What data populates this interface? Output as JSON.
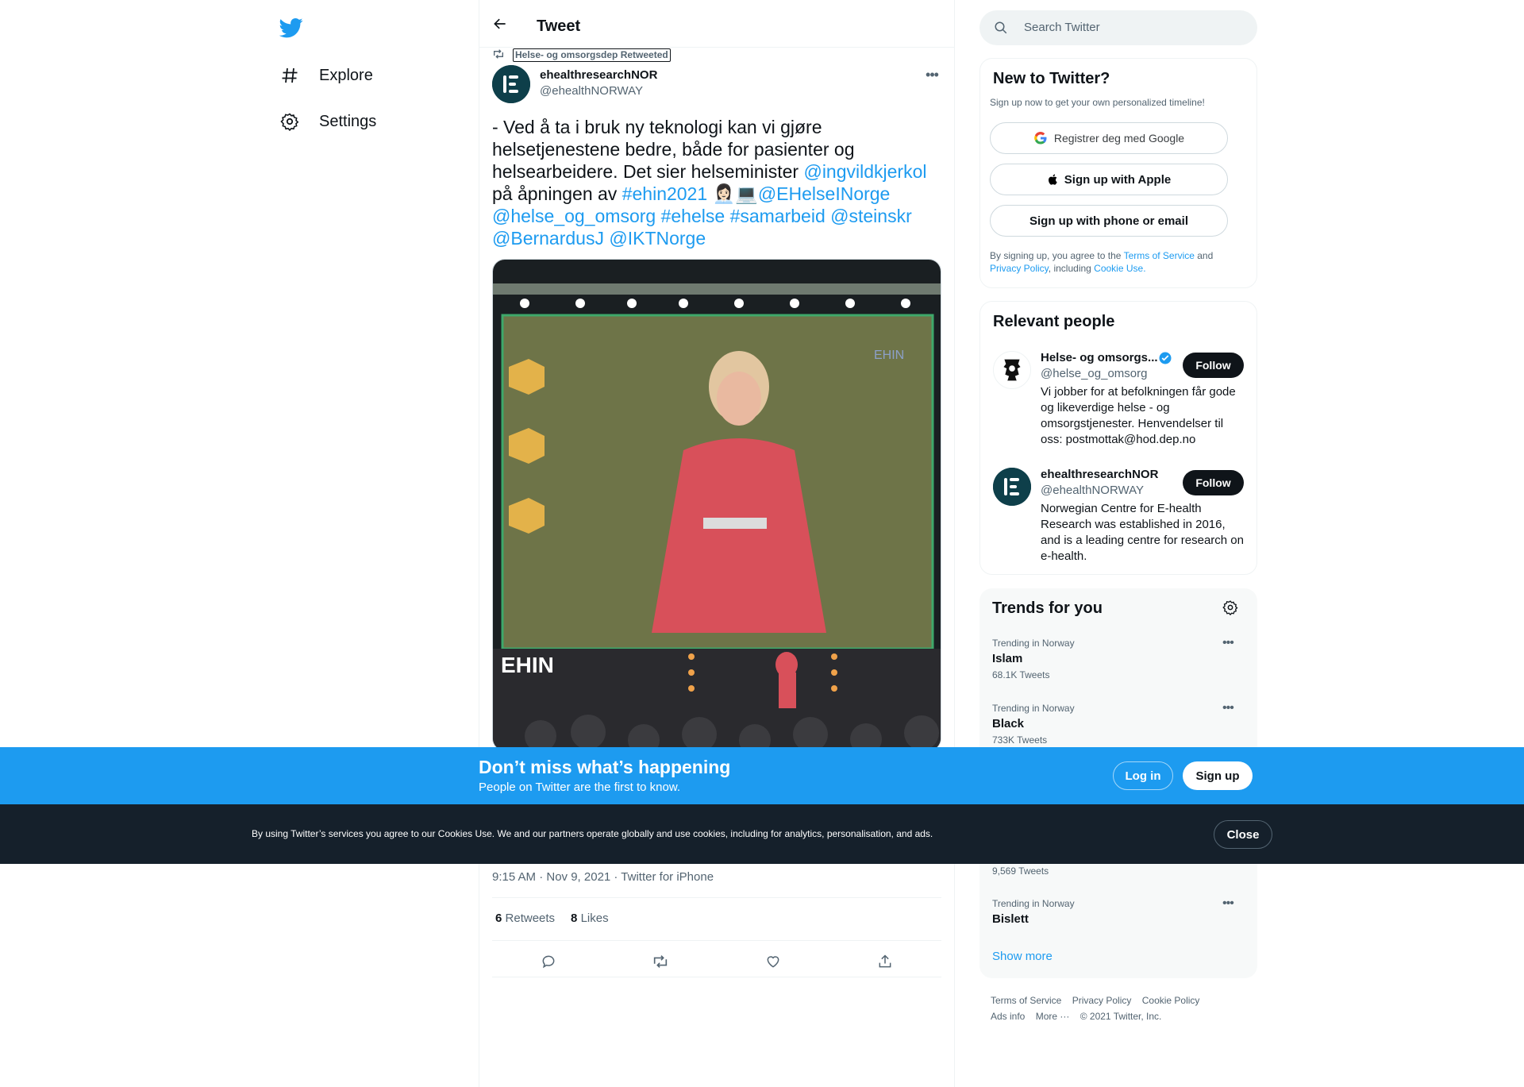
{
  "nav": {
    "items": [
      {
        "label": "Explore",
        "icon": "hashtag-icon"
      },
      {
        "label": "Settings",
        "icon": "gear-icon"
      }
    ]
  },
  "header": {
    "title": "Tweet"
  },
  "tweet": {
    "retweeted_by": "Helse- og omsorgsdep Retweeted",
    "author_name": "ehealthresearchNOR",
    "author_handle": "@ehealthNORWAY",
    "text_parts": {
      "p1": "- Ved å ta i bruk ny teknologi kan vi gjøre helsetjenestene bedre, både for pasienter og helsearbeidere. Det sier helseminister ",
      "m1": "@ingvildkjerkol",
      "p2": " på åpningen av ",
      "h1": "#ehin2021",
      "emoji": " 👩🏻‍💼💻",
      "m2": "@EHelseINorge",
      "m3": "@helse_og_omsorg",
      "h2": "#ehelse",
      "h3": "#samarbeid",
      "m4": "@steinskr",
      "m5": "@BernardusJ",
      "m6": "@IKTNorge"
    },
    "timestamp": "9:15 AM · Nov 9, 2021 · Twitter for iPhone",
    "retweets_count": "6",
    "retweets_label": "Retweets",
    "likes_count": "8",
    "likes_label": "Likes"
  },
  "search": {
    "placeholder": "Search Twitter"
  },
  "signup_card": {
    "title": "New to Twitter?",
    "subtitle": "Sign up now to get your own personalized timeline!",
    "google_label": "Registrer deg med Google",
    "apple_label": "Sign up with Apple",
    "phone_label": "Sign up with phone or email",
    "legal_1": "By signing up, you agree to the ",
    "terms": "Terms of Service",
    "legal_2": " and ",
    "privacy": "Privacy Policy",
    "legal_3": ", including ",
    "cookie": "Cookie Use."
  },
  "relevant": {
    "title": "Relevant people",
    "people": [
      {
        "name": "Helse- og omsorgs...",
        "handle": "@helse_og_omsorg",
        "bio": "Vi jobber for at befolkningen får gode og likeverdige helse - og omsorgstjenester. Henvendelser til oss: postmottak@hod.dep.no",
        "follow": "Follow"
      },
      {
        "name": "ehealthresearchNOR",
        "handle": "@ehealthNORWAY",
        "bio": "Norwegian Centre for E-health Research was established in 2016, and is a leading centre for research on e-health.",
        "follow": "Follow"
      }
    ]
  },
  "trends": {
    "title": "Trends for you",
    "items": [
      {
        "context": "Trending in Norway",
        "name": "Islam",
        "count": "68.1K Tweets"
      },
      {
        "context": "Trending in Norway",
        "name": "Black",
        "count": "733K Tweets"
      },
      {
        "context": "",
        "name": "",
        "count": "9,569 Tweets"
      },
      {
        "context": "Trending in Norway",
        "name": "Bislett",
        "count": ""
      }
    ],
    "show_more": "Show more"
  },
  "footer": {
    "links": [
      "Terms of Service",
      "Privacy Policy",
      "Cookie Policy",
      "Ads info",
      "More ···",
      "© 2021 Twitter, Inc."
    ]
  },
  "banner": {
    "title": "Don’t miss what’s happening",
    "subtitle": "People on Twitter are the first to know.",
    "login": "Log in",
    "signup": "Sign up"
  },
  "cookie_bar": {
    "text": "By using Twitter’s services you agree to our Cookies Use. We and our partners operate globally and use cookies, including for analytics, personalisation, and ads.",
    "close": "Close"
  },
  "colors": {
    "accent": "#1d9bf0",
    "dark": "#0f1419",
    "muted": "#536471",
    "cookie_bg": "#15202b"
  }
}
